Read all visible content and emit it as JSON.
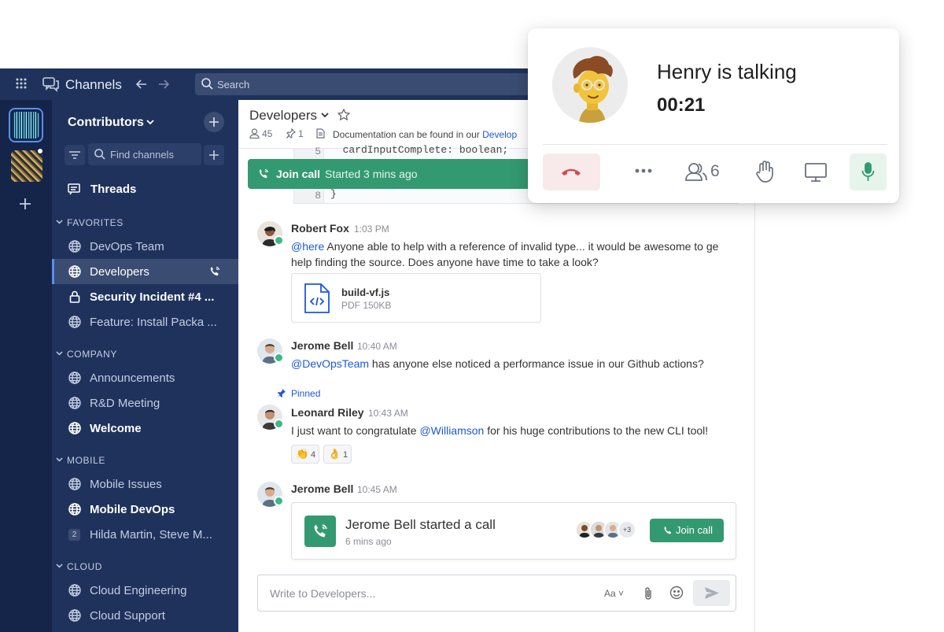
{
  "topbar": {
    "title": "Channels",
    "search_placeholder": "Search"
  },
  "sidebar": {
    "team_name": "Contributors",
    "find_placeholder": "Find channels",
    "threads_label": "Threads",
    "sections": [
      {
        "title": "FAVORITES",
        "items": [
          {
            "label": "DevOps Team",
            "icon": "globe-icon",
            "state": "normal"
          },
          {
            "label": "Developers",
            "icon": "globe-icon",
            "state": "active"
          },
          {
            "label": "Security Incident #4 ...",
            "icon": "lock-icon",
            "state": "unread"
          },
          {
            "label": "Feature: Install Packa ...",
            "icon": "globe-icon",
            "state": "normal"
          }
        ]
      },
      {
        "title": "COMPANY",
        "items": [
          {
            "label": "Announcements",
            "icon": "globe-icon",
            "state": "normal"
          },
          {
            "label": "R&D Meeting",
            "icon": "globe-icon",
            "state": "normal"
          },
          {
            "label": "Welcome",
            "icon": "globe-icon",
            "state": "unread"
          }
        ]
      },
      {
        "title": "MOBILE",
        "items": [
          {
            "label": "Mobile Issues",
            "icon": "globe-icon",
            "state": "normal"
          },
          {
            "label": "Mobile DevOps",
            "icon": "globe-icon",
            "state": "unread"
          },
          {
            "label": "Hilda Martin, Steve M...",
            "icon": "group-dm-icon",
            "badge": "2",
            "state": "normal"
          }
        ]
      },
      {
        "title": "CLOUD",
        "items": [
          {
            "label": "Cloud Engineering",
            "icon": "globe-icon",
            "state": "normal"
          },
          {
            "label": "Cloud Support",
            "icon": "globe-icon",
            "state": "normal"
          }
        ]
      }
    ]
  },
  "channel": {
    "name": "Developers",
    "member_count": "45",
    "pinned_count": "1",
    "header_text": "Documentation can be found in our ",
    "header_link": "Develop",
    "code_lines": [
      {
        "num": "5",
        "text": "  cardInputComplete: boolean;"
      },
      {
        "num": "8",
        "text": "}"
      }
    ],
    "join_bar": {
      "label": "Join call",
      "status": "Started 3 mins ago"
    }
  },
  "posts": [
    {
      "author": "Robert Fox",
      "time": "1:03 PM",
      "mention": "@here",
      "text": " Anyone able to help with a reference of invalid type... it would be awesome to ge",
      "text2": "help finding the source. Does anyone have time to take a look?",
      "file": {
        "name": "build-vf.js",
        "meta": "PDF 150KB"
      }
    },
    {
      "author": "Jerome Bell",
      "time": "10:40 AM",
      "mention": "@DevOpsTeam",
      "text": " has anyone else noticed a performance issue in our Github actions?"
    },
    {
      "pinned_label": "Pinned",
      "author": "Leonard Riley",
      "time": "10:43 AM",
      "text_before": "I just want to congratulate ",
      "mention": "@Williamson",
      "text_after": " for his huge contributions to the new CLI tool!",
      "reactions": [
        {
          "emoji": "👏",
          "count": "4"
        },
        {
          "emoji": "👌",
          "count": "1"
        }
      ]
    },
    {
      "author": "Jerome Bell",
      "time": "10:45 AM",
      "call": {
        "title": "Jerome Bell started a call",
        "subtitle": "6 mins ago",
        "more": "+3",
        "join_label": "Join call"
      }
    }
  ],
  "composer": {
    "placeholder": "Write to Developers...",
    "format_label": "Aa"
  },
  "call_popup": {
    "title": "Henry is talking",
    "timer": "00:21",
    "participants": "6"
  },
  "colors": {
    "sidebar": "#1e325c",
    "topbar": "#1e325c",
    "accent_green": "#339970",
    "link": "#1c58d9",
    "hangup": "#d24b4e"
  }
}
